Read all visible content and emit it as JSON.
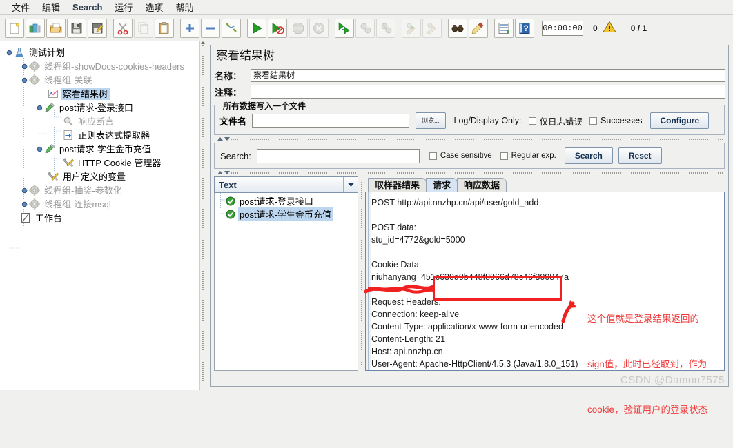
{
  "menu": {
    "items": [
      {
        "label": "文件",
        "lang": "zh"
      },
      {
        "label": "编辑",
        "lang": "zh"
      },
      {
        "label": "Search",
        "lang": "en"
      },
      {
        "label": "运行",
        "lang": "zh"
      },
      {
        "label": "选项",
        "lang": "zh"
      },
      {
        "label": "帮助",
        "lang": "zh"
      }
    ]
  },
  "toolbar": {
    "buttons": [
      {
        "name": "new-icon"
      },
      {
        "name": "templates-icon"
      },
      {
        "name": "open-icon"
      },
      {
        "name": "save-icon"
      },
      {
        "name": "save-as-icon"
      },
      {
        "name": "cut-icon"
      },
      {
        "name": "copy-icon"
      },
      {
        "name": "paste-icon"
      },
      {
        "name": "expand-icon"
      },
      {
        "name": "collapse-icon"
      },
      {
        "name": "toggle-icon"
      },
      {
        "name": "start-icon"
      },
      {
        "name": "start-no-pauses-icon"
      },
      {
        "name": "stop-icon"
      },
      {
        "name": "shutdown-icon"
      },
      {
        "name": "start-remote-icon"
      },
      {
        "name": "stop-remote-icon"
      },
      {
        "name": "shutdown-remote-icon"
      },
      {
        "name": "clear-icon"
      },
      {
        "name": "clear-all-icon"
      },
      {
        "name": "search-icon"
      },
      {
        "name": "reset-search-icon"
      },
      {
        "name": "function-helper-icon"
      },
      {
        "name": "help-icon"
      }
    ],
    "timer": "00:00:00",
    "warnings": "0",
    "threads": "0 / 1"
  },
  "tree": {
    "nodes": [
      {
        "label": "测试计划",
        "icon": "test-plan-icon",
        "depth": 0,
        "state": "normal",
        "handle": "expanded"
      },
      {
        "label": "线程组-showDocs-cookies-headers",
        "icon": "thread-group-icon",
        "depth": 1,
        "state": "disabled",
        "handle": "collapsed"
      },
      {
        "label": "线程组-关联",
        "icon": "thread-group-icon",
        "depth": 1,
        "state": "disabled",
        "handle": "expanded"
      },
      {
        "label": "察看结果树",
        "icon": "view-results-tree-icon",
        "depth": 2,
        "state": "selected",
        "handle": "none"
      },
      {
        "label": "post请求-登录接口",
        "icon": "http-sampler-icon",
        "depth": 2,
        "state": "normal",
        "handle": "expanded"
      },
      {
        "label": "响应断言",
        "icon": "assertion-icon",
        "depth": 3,
        "state": "disabled",
        "handle": "none"
      },
      {
        "label": "正则表达式提取器",
        "icon": "regex-extractor-icon",
        "depth": 3,
        "state": "normal",
        "handle": "none"
      },
      {
        "label": "post请求-学生金币充值",
        "icon": "http-sampler-icon",
        "depth": 2,
        "state": "normal",
        "handle": "expanded"
      },
      {
        "label": "HTTP Cookie 管理器",
        "icon": "config-element-icon",
        "depth": 3,
        "state": "normal",
        "handle": "none"
      },
      {
        "label": "用户定义的变量",
        "icon": "config-element-icon",
        "depth": 2,
        "state": "normal",
        "handle": "none"
      },
      {
        "label": "线程组-抽奖-参数化",
        "icon": "thread-group-icon",
        "depth": 1,
        "state": "disabled",
        "handle": "collapsed"
      },
      {
        "label": "线程组-连接msql",
        "icon": "thread-group-icon",
        "depth": 1,
        "state": "disabled",
        "handle": "collapsed"
      },
      {
        "label": "工作台",
        "icon": "workbench-icon",
        "depth": 0,
        "state": "normal",
        "handle": "none"
      }
    ]
  },
  "panel": {
    "title": "察看结果树",
    "name_label": "名称：",
    "name_value": "察看结果树",
    "comment_label": "注释：",
    "comment_value": "",
    "filegroup": {
      "legend": "所有数据写入一个文件",
      "filename_label": "文件名",
      "filename_value": "",
      "filename_placeholder": "",
      "browse_button": "浏览...",
      "log_display_only_label": "Log/Display Only:",
      "errors_checkbox": "仅日志错误",
      "errors_checked": false,
      "successes_checkbox": "Successes",
      "successes_checked": false,
      "configure_button": "Configure"
    },
    "search": {
      "label": "Search:",
      "value": "",
      "case_sensitive": "Case sensitive",
      "case_sensitive_checked": false,
      "regular_exp": "Regular exp.",
      "regular_exp_checked": false,
      "search_button": "Search",
      "reset_button": "Reset"
    },
    "renderer": {
      "selected": "Text"
    },
    "sampler_list": [
      {
        "label": "post请求-登录接口",
        "status": "success",
        "selected": false
      },
      {
        "label": "post请求-学生金币充值",
        "status": "success",
        "selected": true
      }
    ],
    "tabs": [
      {
        "label": "取样器结果",
        "active": false
      },
      {
        "label": "请求",
        "active": true
      },
      {
        "label": "响应数据",
        "active": false
      }
    ],
    "request_text": [
      "POST http://api.nnzhp.cn/api/user/gold_add",
      "",
      "POST data:",
      "stu_id=4772&gold=5000",
      "",
      "Cookie Data:",
      "niuhanyang=451c630d0b448f8066d78c46f300847a",
      "",
      "Request Headers:",
      "Connection: keep-alive",
      "Content-Type: application/x-www-form-urlencoded",
      "Content-Length: 21",
      "Host: api.nnzhp.cn",
      "User-Agent: Apache-HttpClient/4.5.3 (Java/1.8.0_151)"
    ]
  },
  "annotations": {
    "note_lines": [
      "这个值就是登录结果返回的",
      "sign值，此时已经取到，作为",
      "cookie，验证用户的登录状态"
    ],
    "highlight_color": "#ef2121",
    "note_color": "#ef3b3b"
  },
  "watermark": "CSDN @Damon7575"
}
